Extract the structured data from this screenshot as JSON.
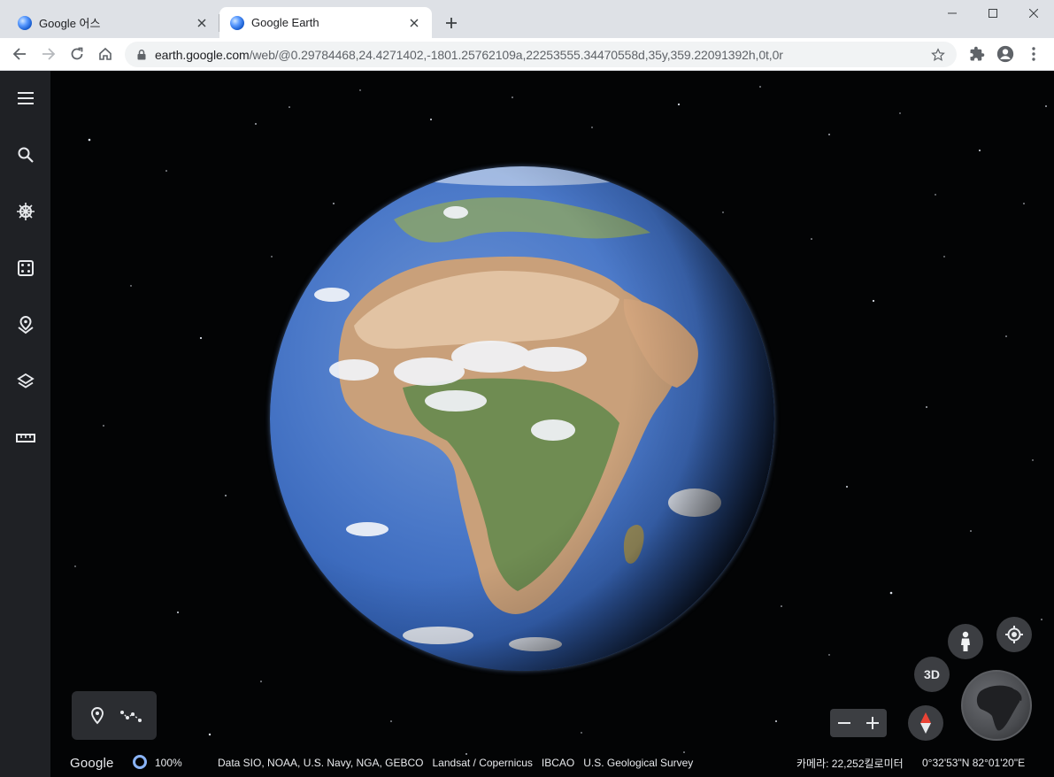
{
  "browser": {
    "tabs": [
      {
        "title": "Google 어스",
        "active": false
      },
      {
        "title": "Google Earth",
        "active": true
      }
    ],
    "url_host": "earth.google.com",
    "url_path": "/web/@0.29784468,24.4271402,-1801.25762109a,22253555.34470558d,35y,359.22091392h,0t,0r"
  },
  "icons": {
    "back": "arrow-left-icon",
    "forward": "arrow-right-icon",
    "reload": "reload-icon",
    "home": "home-icon",
    "lock": "lock-icon",
    "bookmark": "star-icon",
    "extensions": "puzzle-icon",
    "profile": "account-icon",
    "menu": "kebab-menu-icon"
  },
  "rail": {
    "items": [
      {
        "name": "menu",
        "icon": "hamburger-icon"
      },
      {
        "name": "search",
        "icon": "search-icon"
      },
      {
        "name": "voyager",
        "icon": "ship-wheel-icon"
      },
      {
        "name": "feeling-lucky",
        "icon": "dice-icon"
      },
      {
        "name": "projects",
        "icon": "map-pin-stack-icon"
      },
      {
        "name": "map-style",
        "icon": "layers-icon"
      },
      {
        "name": "measure",
        "icon": "ruler-icon"
      }
    ]
  },
  "status": {
    "logo": "Google",
    "load_percent": "100%",
    "attribution": "Data SIO, NOAA, U.S. Navy, NGA, GEBCO   Landsat / Copernicus   IBCAO   U.S. Geological Survey",
    "camera": "카메라: 22,252킬로미터",
    "coords": "0°32'53\"N 82°01'20\"E"
  },
  "controls": {
    "three_d": "3D"
  },
  "colors": {
    "rail_bg": "#1f2125",
    "space_bg": "#030405",
    "accent": "#8ab4f8",
    "compass_red": "#ea4335"
  }
}
